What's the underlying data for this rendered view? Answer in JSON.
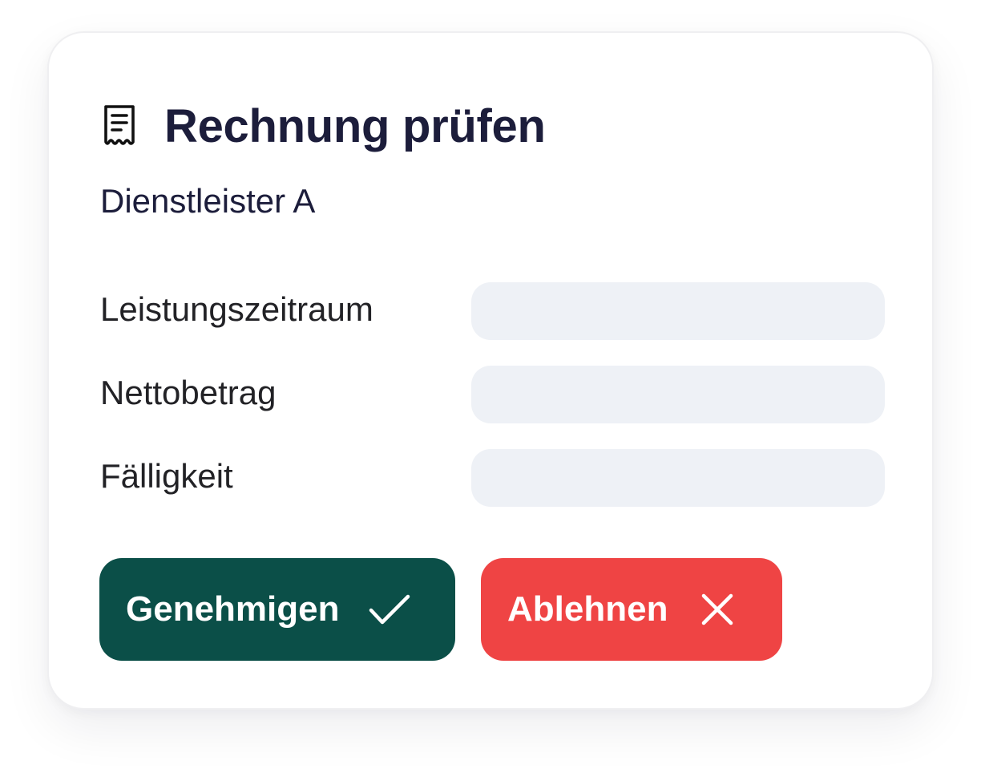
{
  "dialog": {
    "icon": "receipt-icon",
    "title": "Rechnung prüfen",
    "subtitle": "Dienstleister A"
  },
  "fields": [
    {
      "label": "Leistungszeitraum",
      "value": ""
    },
    {
      "label": "Nettobetrag",
      "value": ""
    },
    {
      "label": "Fälligkeit",
      "value": ""
    }
  ],
  "actions": {
    "approve": {
      "label": "Genehmigen",
      "icon": "check-icon",
      "color": "#0b4f48"
    },
    "reject": {
      "label": "Ablehnen",
      "icon": "close-icon",
      "color": "#ef4444"
    }
  },
  "colors": {
    "text": "#1c1d3b",
    "input_background": "#eef1f6"
  }
}
